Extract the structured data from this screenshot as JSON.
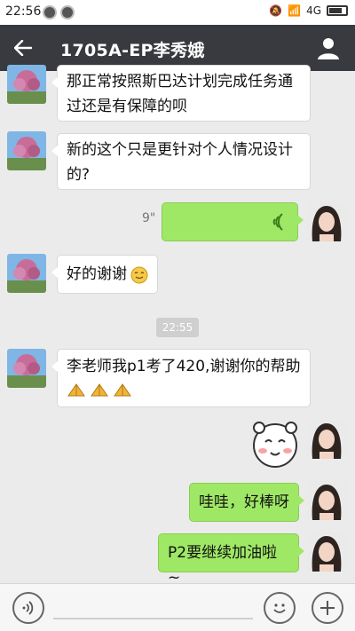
{
  "status_bar": {
    "time": "22:56",
    "network": "4G"
  },
  "header": {
    "title": "1705A-EP李秀娥"
  },
  "messages": {
    "m1": "那正常按照斯巴达计划完成任务通过还是有保障的呗",
    "m1_line1": "那正常按照斯巴达计划完成任务通",
    "m1_line2": "过还是有保障的呗",
    "m2_line1": "新的这个只是更针对个人情况设计",
    "m2_line2": "的?",
    "voice_duration": "9\"",
    "m4": "好的谢谢",
    "timestamp": "22:55",
    "m5_line1": "李老师我p1考了420,谢谢你的帮助",
    "m6": "哇哇，好棒呀",
    "m7": "P2要继续加油啦~"
  },
  "colors": {
    "header_bg": "#393a3f",
    "outgoing_bubble": "#9fe866",
    "incoming_bubble": "#ffffff",
    "chat_bg": "#ebebeb"
  },
  "icons": [
    "back-arrow-icon",
    "profile-icon",
    "voice-wave-icon",
    "smile-emoji-icon",
    "pray-emoji-icon",
    "bear-sticker",
    "voice-input-icon",
    "emoji-icon",
    "plus-icon"
  ]
}
